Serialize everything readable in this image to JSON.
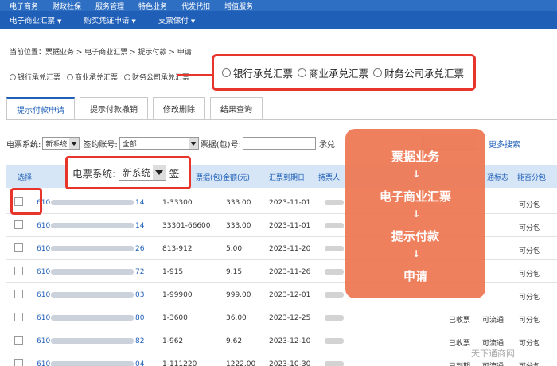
{
  "top_nav": [
    "电子商务",
    "财政社保",
    "服务管理",
    "特色业务",
    "代发代扣",
    "增值服务"
  ],
  "sub_nav": [
    "电子商业汇票",
    "购买凭证申请",
    "支票保付"
  ],
  "breadcrumb": "当前位置：票据业务 > 电子商业汇票 > 提示付款 > 申请",
  "radio_options": [
    "银行承兑汇票",
    "商业承兑汇票",
    "财务公司承兑汇票"
  ],
  "tabs": [
    "提示付款申请",
    "提示付款撤销",
    "修改删除",
    "结果查询"
  ],
  "filter": {
    "system_label": "电票系统:",
    "system_value": "新系统",
    "account_label": "签约账号:",
    "account_value": "全部",
    "bill_label": "票据(包)号:",
    "accept_label": "承兑",
    "more_search": "更多搜索"
  },
  "zoom_filter": {
    "label": "电票系统:",
    "value": "新系统",
    "tail": "签"
  },
  "table": {
    "headers": [
      "选择",
      "票据(包)金额(元)",
      "汇票到期日",
      "持票人",
      "通标志",
      "能否分包"
    ],
    "rows": [
      {
        "prefix": "610",
        "suffix": "14",
        "range": "1-33300",
        "amount": "333.00",
        "due": "2023-11-01",
        "status": "",
        "circ": "",
        "split": "可分包"
      },
      {
        "prefix": "610",
        "suffix": "14",
        "range": "33301-66600",
        "amount": "333.00",
        "due": "2023-11-01",
        "status": "",
        "circ": "",
        "split": "可分包"
      },
      {
        "prefix": "610",
        "suffix": "26",
        "range": "813-912",
        "amount": "5.00",
        "due": "2023-11-20",
        "status": "",
        "circ": "",
        "split": "可分包"
      },
      {
        "prefix": "610",
        "suffix": "72",
        "range": "1-915",
        "amount": "9.15",
        "due": "2023-11-26",
        "status": "",
        "circ": "",
        "split": "可分包"
      },
      {
        "prefix": "610",
        "suffix": "03",
        "range": "1-99900",
        "amount": "999.00",
        "due": "2023-12-01",
        "status": "",
        "circ": "",
        "split": "可分包"
      },
      {
        "prefix": "610",
        "suffix": "80",
        "range": "1-3600",
        "amount": "36.00",
        "due": "2023-12-25",
        "status": "已收票",
        "circ": "可流通",
        "split": "可分包"
      },
      {
        "prefix": "610",
        "suffix": "82",
        "range": "1-962",
        "amount": "9.62",
        "due": "2023-12-10",
        "status": "已收票",
        "circ": "可流通",
        "split": "可分包"
      },
      {
        "prefix": "610",
        "suffix": "04",
        "range": "1-111220",
        "amount": "1222.00",
        "due": "2023-10-30",
        "status": "已到期",
        "circ": "可流通",
        "split": "可分包"
      }
    ]
  },
  "flow_steps": [
    "票据业务",
    "电子商业汇票",
    "提示付款",
    "申请"
  ],
  "flow_arrow": "↓",
  "watermark": "天下通商网"
}
